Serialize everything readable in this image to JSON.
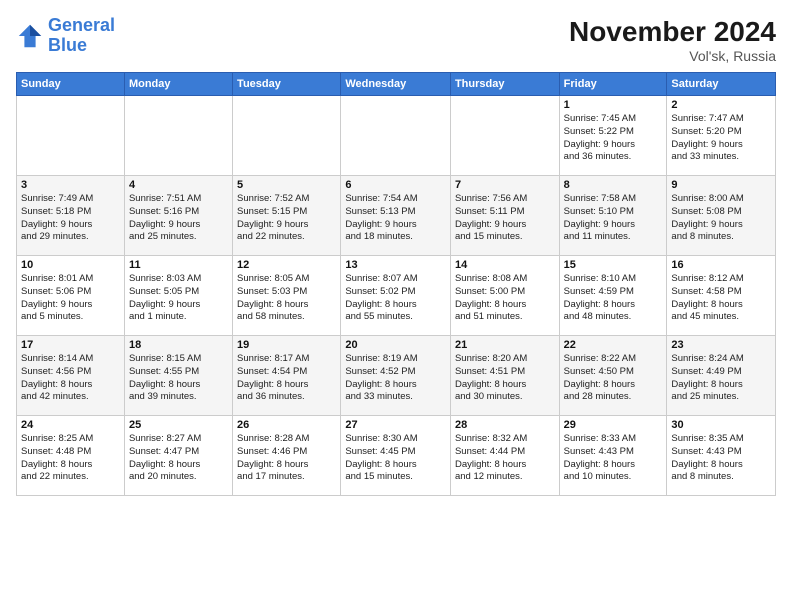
{
  "logo": {
    "line1": "General",
    "line2": "Blue"
  },
  "title": "November 2024",
  "location": "Vol'sk, Russia",
  "days_header": [
    "Sunday",
    "Monday",
    "Tuesday",
    "Wednesday",
    "Thursday",
    "Friday",
    "Saturday"
  ],
  "weeks": [
    [
      {
        "day": "",
        "info": ""
      },
      {
        "day": "",
        "info": ""
      },
      {
        "day": "",
        "info": ""
      },
      {
        "day": "",
        "info": ""
      },
      {
        "day": "",
        "info": ""
      },
      {
        "day": "1",
        "info": "Sunrise: 7:45 AM\nSunset: 5:22 PM\nDaylight: 9 hours\nand 36 minutes."
      },
      {
        "day": "2",
        "info": "Sunrise: 7:47 AM\nSunset: 5:20 PM\nDaylight: 9 hours\nand 33 minutes."
      }
    ],
    [
      {
        "day": "3",
        "info": "Sunrise: 7:49 AM\nSunset: 5:18 PM\nDaylight: 9 hours\nand 29 minutes."
      },
      {
        "day": "4",
        "info": "Sunrise: 7:51 AM\nSunset: 5:16 PM\nDaylight: 9 hours\nand 25 minutes."
      },
      {
        "day": "5",
        "info": "Sunrise: 7:52 AM\nSunset: 5:15 PM\nDaylight: 9 hours\nand 22 minutes."
      },
      {
        "day": "6",
        "info": "Sunrise: 7:54 AM\nSunset: 5:13 PM\nDaylight: 9 hours\nand 18 minutes."
      },
      {
        "day": "7",
        "info": "Sunrise: 7:56 AM\nSunset: 5:11 PM\nDaylight: 9 hours\nand 15 minutes."
      },
      {
        "day": "8",
        "info": "Sunrise: 7:58 AM\nSunset: 5:10 PM\nDaylight: 9 hours\nand 11 minutes."
      },
      {
        "day": "9",
        "info": "Sunrise: 8:00 AM\nSunset: 5:08 PM\nDaylight: 9 hours\nand 8 minutes."
      }
    ],
    [
      {
        "day": "10",
        "info": "Sunrise: 8:01 AM\nSunset: 5:06 PM\nDaylight: 9 hours\nand 5 minutes."
      },
      {
        "day": "11",
        "info": "Sunrise: 8:03 AM\nSunset: 5:05 PM\nDaylight: 9 hours\nand 1 minute."
      },
      {
        "day": "12",
        "info": "Sunrise: 8:05 AM\nSunset: 5:03 PM\nDaylight: 8 hours\nand 58 minutes."
      },
      {
        "day": "13",
        "info": "Sunrise: 8:07 AM\nSunset: 5:02 PM\nDaylight: 8 hours\nand 55 minutes."
      },
      {
        "day": "14",
        "info": "Sunrise: 8:08 AM\nSunset: 5:00 PM\nDaylight: 8 hours\nand 51 minutes."
      },
      {
        "day": "15",
        "info": "Sunrise: 8:10 AM\nSunset: 4:59 PM\nDaylight: 8 hours\nand 48 minutes."
      },
      {
        "day": "16",
        "info": "Sunrise: 8:12 AM\nSunset: 4:58 PM\nDaylight: 8 hours\nand 45 minutes."
      }
    ],
    [
      {
        "day": "17",
        "info": "Sunrise: 8:14 AM\nSunset: 4:56 PM\nDaylight: 8 hours\nand 42 minutes."
      },
      {
        "day": "18",
        "info": "Sunrise: 8:15 AM\nSunset: 4:55 PM\nDaylight: 8 hours\nand 39 minutes."
      },
      {
        "day": "19",
        "info": "Sunrise: 8:17 AM\nSunset: 4:54 PM\nDaylight: 8 hours\nand 36 minutes."
      },
      {
        "day": "20",
        "info": "Sunrise: 8:19 AM\nSunset: 4:52 PM\nDaylight: 8 hours\nand 33 minutes."
      },
      {
        "day": "21",
        "info": "Sunrise: 8:20 AM\nSunset: 4:51 PM\nDaylight: 8 hours\nand 30 minutes."
      },
      {
        "day": "22",
        "info": "Sunrise: 8:22 AM\nSunset: 4:50 PM\nDaylight: 8 hours\nand 28 minutes."
      },
      {
        "day": "23",
        "info": "Sunrise: 8:24 AM\nSunset: 4:49 PM\nDaylight: 8 hours\nand 25 minutes."
      }
    ],
    [
      {
        "day": "24",
        "info": "Sunrise: 8:25 AM\nSunset: 4:48 PM\nDaylight: 8 hours\nand 22 minutes."
      },
      {
        "day": "25",
        "info": "Sunrise: 8:27 AM\nSunset: 4:47 PM\nDaylight: 8 hours\nand 20 minutes."
      },
      {
        "day": "26",
        "info": "Sunrise: 8:28 AM\nSunset: 4:46 PM\nDaylight: 8 hours\nand 17 minutes."
      },
      {
        "day": "27",
        "info": "Sunrise: 8:30 AM\nSunset: 4:45 PM\nDaylight: 8 hours\nand 15 minutes."
      },
      {
        "day": "28",
        "info": "Sunrise: 8:32 AM\nSunset: 4:44 PM\nDaylight: 8 hours\nand 12 minutes."
      },
      {
        "day": "29",
        "info": "Sunrise: 8:33 AM\nSunset: 4:43 PM\nDaylight: 8 hours\nand 10 minutes."
      },
      {
        "day": "30",
        "info": "Sunrise: 8:35 AM\nSunset: 4:43 PM\nDaylight: 8 hours\nand 8 minutes."
      }
    ]
  ]
}
